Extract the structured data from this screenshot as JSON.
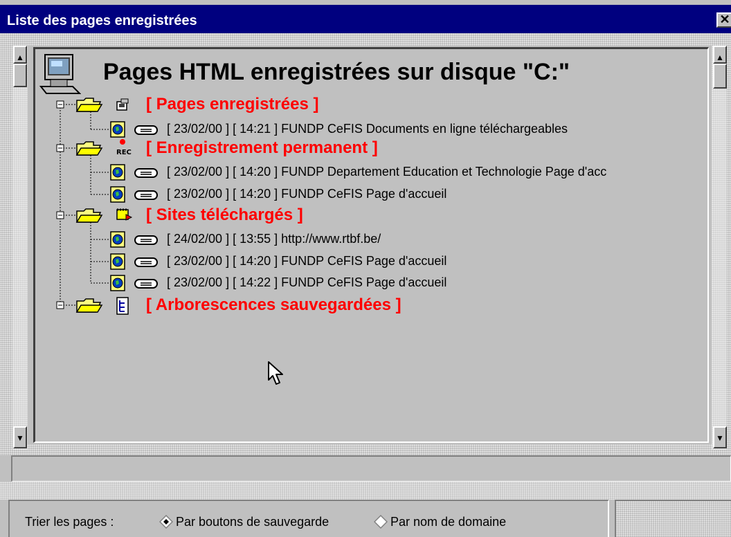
{
  "window": {
    "title": "Liste des pages enregistrées",
    "close_glyph": "✕"
  },
  "tree": {
    "header": "Pages HTML enregistrées sur disque  \"C:\"",
    "header_icon": "computer-icon",
    "folders": [
      {
        "label": "[ Pages enregistrées ]",
        "icon": "save-pages-icon",
        "items": [
          {
            "date": "[ 23/02/00 ]",
            "time": "[ 14:21 ]",
            "title": "FUNDP CeFIS Documents en ligne téléchargeables"
          }
        ]
      },
      {
        "label": "[ Enregistrement permanent ]",
        "icon": "rec-icon",
        "icon_text": "REC",
        "items": [
          {
            "date": "[ 23/02/00 ]",
            "time": "[ 14:20 ]",
            "title": "FUNDP Departement Education et Technologie Page d'acc"
          },
          {
            "date": "[ 23/02/00 ]",
            "time": "[ 14:20 ]",
            "title": "FUNDP CeFIS Page d'accueil"
          }
        ]
      },
      {
        "label": "[ Sites téléchargés ]",
        "icon": "download-sites-icon",
        "items": [
          {
            "date": "[ 24/02/00 ]",
            "time": "[ 13:55 ]",
            "title": "http://www.rtbf.be/"
          },
          {
            "date": "[ 23/02/00 ]",
            "time": "[ 14:20 ]",
            "title": "FUNDP CeFIS Page d'accueil"
          },
          {
            "date": "[ 23/02/00 ]",
            "time": "[ 14:22 ]",
            "title": "FUNDP CeFIS Page d'accueil"
          }
        ]
      },
      {
        "label": "[ Arborescences sauvegardées ]",
        "icon": "tree-saved-icon",
        "items": []
      }
    ],
    "page_icon": "html-page-icon",
    "drive_icon": "disk-drive-icon"
  },
  "scrollbar": {
    "up_glyph": "▲",
    "down_glyph": "▼"
  },
  "status_bar": {
    "text": ""
  },
  "sort": {
    "label": "Trier les pages :",
    "options": [
      {
        "label": "Par boutons de sauvegarde",
        "selected": true
      },
      {
        "label": "Par nom de domaine",
        "selected": false
      }
    ]
  },
  "colors": {
    "title_bar": "#00007f",
    "folder_label": "#ff0000",
    "background": "#c0c0c0"
  }
}
